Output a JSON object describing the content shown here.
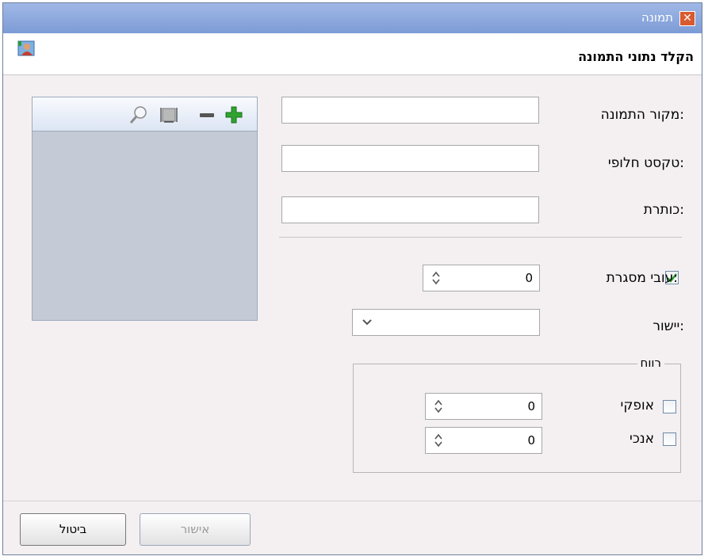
{
  "window": {
    "title": "תמונה",
    "close_glyph": "✕"
  },
  "header": {
    "title": "הקלד נתוני התמונה",
    "icon": "picture-user-icon"
  },
  "fields": {
    "source_label": "מקור התמונה:",
    "source_value": "",
    "alt_label": "טקסט חלופי:",
    "alt_value": "",
    "caption_label": "כותרת:",
    "caption_value": ""
  },
  "border": {
    "label": "עובי מסגרת:",
    "checked": true,
    "value": "0"
  },
  "align": {
    "label": "יישור:",
    "value": ""
  },
  "spacing": {
    "legend": "רווח",
    "horizontal_label": "אופקי",
    "horizontal_checked": false,
    "horizontal_value": "0",
    "vertical_label": "אנכי",
    "vertical_checked": false,
    "vertical_value": "0"
  },
  "preview_toolbar": [
    "zoom-icon",
    "fit-icon",
    "minus-icon",
    "plus-icon"
  ],
  "buttons": {
    "ok": "אישור",
    "cancel": "ביטול"
  },
  "colors": {
    "titlebar": "#7c9bd6",
    "close": "#d85a2e",
    "plus": "#2fa32f",
    "checkmark": "#2b9a2b"
  }
}
